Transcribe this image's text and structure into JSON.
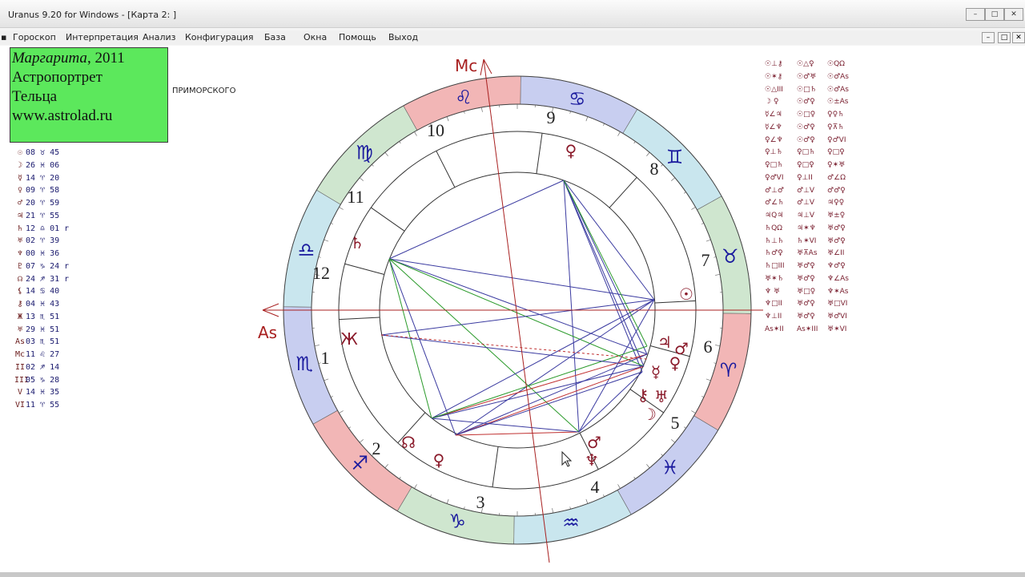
{
  "window": {
    "title": "Uranus 9.20 for Windows - [Карта 2: ]",
    "controls": [
      "–",
      "□",
      "✕"
    ],
    "mdi_controls": [
      "–",
      "□",
      "✕"
    ]
  },
  "menu": [
    "Гороскоп",
    "Интерпретация",
    "Анализ",
    "Конфигурация",
    "База",
    "Окна",
    "Помощь",
    "Выход"
  ],
  "info": {
    "name": "Маргарита",
    "year": ", 2011",
    "line2": "Астропортрет",
    "line3": "Тельца",
    "site": "www.astrolad.ru",
    "place": "ПРИМОРСКОГО"
  },
  "colors": {
    "info_bg": "#5ce85c",
    "sign_glyph": "#1a1a9e",
    "planet_glyph": "#8a1a2a",
    "axis": "#a82020"
  },
  "planets": [
    {
      "g": "☉",
      "t": "08 ♉ 45"
    },
    {
      "g": "☽",
      "t": "26 ♓ 06"
    },
    {
      "g": "☿",
      "t": "14 ♈ 20"
    },
    {
      "g": "♀",
      "t": "09 ♈ 58"
    },
    {
      "g": "♂",
      "t": "20 ♈ 59"
    },
    {
      "g": "♃",
      "t": "21 ♈ 55"
    },
    {
      "g": "♄",
      "t": "12 ♎ 01 r"
    },
    {
      "g": "♅",
      "t": "02 ♈ 39"
    },
    {
      "g": "♆",
      "t": "00 ♓ 36"
    },
    {
      "g": "♇",
      "t": "07 ♑ 24 r"
    },
    {
      "g": "☊",
      "t": "24 ♐ 31 r"
    },
    {
      "g": "⚸",
      "t": "14 ♋ 40"
    },
    {
      "g": "⚷",
      "t": "04 ♓ 43"
    },
    {
      "g": "Ж",
      "t": "13 ♏ 51"
    },
    {
      "g": "♅",
      "t": "29 ♓ 51"
    },
    {
      "g": "As",
      "t": "03 ♏ 51"
    },
    {
      "g": "Mc",
      "t": "11 ♌ 27"
    },
    {
      "g": "II",
      "t": "02 ♐ 14"
    },
    {
      "g": "III",
      "t": "05 ♑ 28"
    },
    {
      "g": "V",
      "t": "14 ♓ 35"
    },
    {
      "g": "VI",
      "t": "11 ♈ 55"
    }
  ],
  "aspects": {
    "col1": [
      "☉⊥⚷",
      "☉✶⚷",
      "☉△III",
      "☽ ♀",
      "☿∠♃",
      "☿∠♆",
      "♀∠♆",
      "♀⊥♄",
      "♀□♄",
      "♀♂VI",
      "♂⊥♂",
      "♂∠♄",
      "♃Q♃",
      "♄QΩ",
      "♄⊥♄",
      "♄♂♀",
      "♄□III",
      "♅✶♄",
      "♆ ♅",
      "♆□II",
      "♆⊥II",
      "As✶II"
    ],
    "col2": [
      "☉△♀",
      "☉♂♅",
      "☉□♄",
      "☉♂♀",
      "☉□♀",
      "☉♂♀",
      "☉♂♀",
      "♀□♄",
      "♀□♀",
      "♀⊥II",
      "♂⊥V",
      "♂⊥V",
      "♃⊥V",
      "♃✶♆",
      "♄✶VI",
      "♅⊼As",
      "♅♂♀",
      "♅♂♀",
      "♅□♀",
      "♅♂♀",
      "♅♂♀",
      "As✶III"
    ],
    "col3": [
      "☉QΩ",
      "☉♂As",
      "☉♂As",
      "☉±As",
      "♀♀♄",
      "♀⊼♄",
      "♀♂VI",
      "♀□♀",
      "♀✶♅",
      "♂∠Ω",
      "♂♂♀",
      "♃♀♀",
      "♅±♀",
      "♅♂♀",
      "♅♂♀",
      "♅∠II",
      "♆♂♀",
      "♆∠As",
      "♆✶As",
      "♅□VI",
      "♅♂VI",
      "♅✶VI"
    ]
  },
  "chart": {
    "asc_label": "As",
    "mc_label": "Mc",
    "houses": [
      "1",
      "2",
      "3",
      "4",
      "5",
      "6",
      "7",
      "8",
      "9",
      "10",
      "11",
      "12"
    ],
    "signs": [
      {
        "sym": "♏",
        "name": "scorpio"
      },
      {
        "sym": "♐",
        "name": "sagittarius"
      },
      {
        "sym": "♑",
        "name": "capricorn"
      },
      {
        "sym": "♒",
        "name": "aquarius"
      },
      {
        "sym": "♓",
        "name": "pisces"
      },
      {
        "sym": "♈",
        "name": "aries"
      },
      {
        "sym": "♉",
        "name": "taurus"
      },
      {
        "sym": "♊",
        "name": "gemini"
      },
      {
        "sym": "♋",
        "name": "cancer"
      },
      {
        "sym": "♌",
        "name": "leo"
      },
      {
        "sym": "♍",
        "name": "virgo"
      },
      {
        "sym": "♎",
        "name": "libra"
      }
    ],
    "planet_glyphs": [
      {
        "sym": "☉",
        "name": "sun"
      },
      {
        "sym": "♃",
        "name": "jupiter"
      },
      {
        "sym": "♂",
        "name": "mars"
      },
      {
        "sym": "☿",
        "name": "mercury"
      },
      {
        "sym": "♀",
        "name": "venus"
      },
      {
        "sym": "♅",
        "name": "uranus"
      },
      {
        "sym": "⚷",
        "name": "chiron"
      },
      {
        "sym": "☽",
        "name": "moon"
      },
      {
        "sym": "♂",
        "name": "mars-2"
      },
      {
        "sym": "♆",
        "name": "neptune"
      },
      {
        "sym": "♀",
        "name": "venus-2"
      },
      {
        "sym": "♀",
        "name": "venus-3"
      },
      {
        "sym": "☊",
        "name": "node"
      },
      {
        "sym": "♄",
        "name": "saturn"
      },
      {
        "sym": "Ж",
        "name": "zh"
      }
    ]
  }
}
